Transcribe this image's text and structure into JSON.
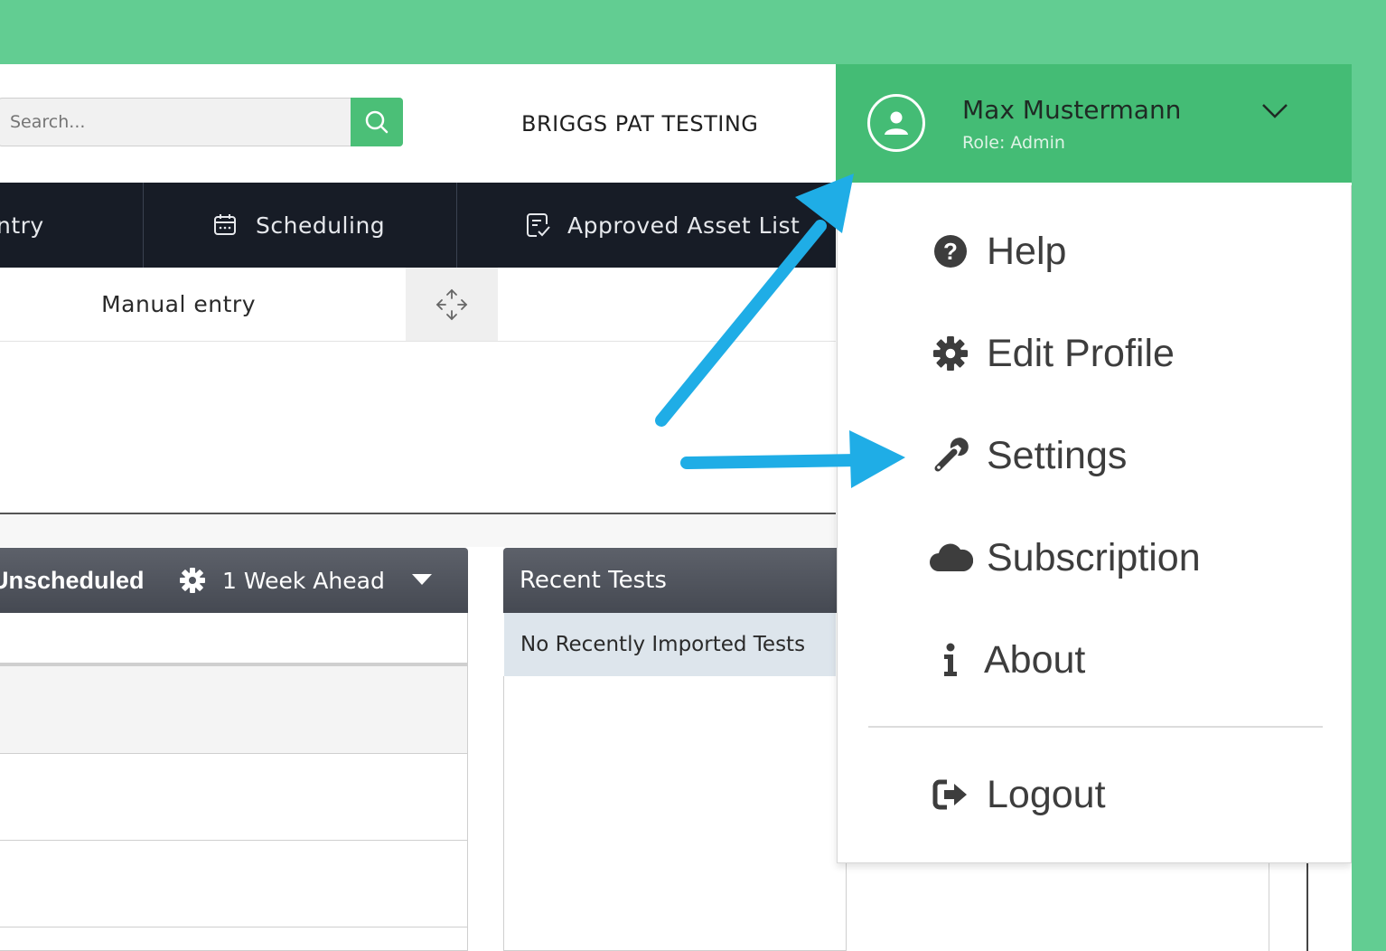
{
  "header": {
    "search_placeholder": "Search...",
    "company_name": "BRIGGS PAT TESTING"
  },
  "user": {
    "name": "Max Mustermann",
    "role": "Role: Admin"
  },
  "nav": {
    "items": [
      {
        "label": "ntry",
        "icon": "none"
      },
      {
        "label": "Scheduling",
        "icon": "calendar-icon"
      },
      {
        "label": "Approved Asset List",
        "icon": "list-check-icon"
      }
    ]
  },
  "subnav": {
    "manual_entry": "Manual entry"
  },
  "panels": {
    "unscheduled": {
      "title": "Unscheduled",
      "filter": "1 Week Ahead"
    },
    "recent_tests": {
      "title": "Recent Tests",
      "empty_text": "No Recently Imported Tests"
    }
  },
  "user_menu": {
    "items": [
      {
        "label": "Help",
        "icon": "question-circle-icon"
      },
      {
        "label": "Edit Profile",
        "icon": "gear-icon"
      },
      {
        "label": "Settings",
        "icon": "wrench-icon"
      },
      {
        "label": "Subscription",
        "icon": "cloud-icon"
      },
      {
        "label": "About",
        "icon": "info-icon"
      },
      {
        "label": "Logout",
        "icon": "sign-out-icon"
      }
    ]
  },
  "colors": {
    "background_green": "#62cd92",
    "header_green": "#44bc75",
    "navbar_dark": "#171c26",
    "arrow_blue": "#1fade6"
  }
}
